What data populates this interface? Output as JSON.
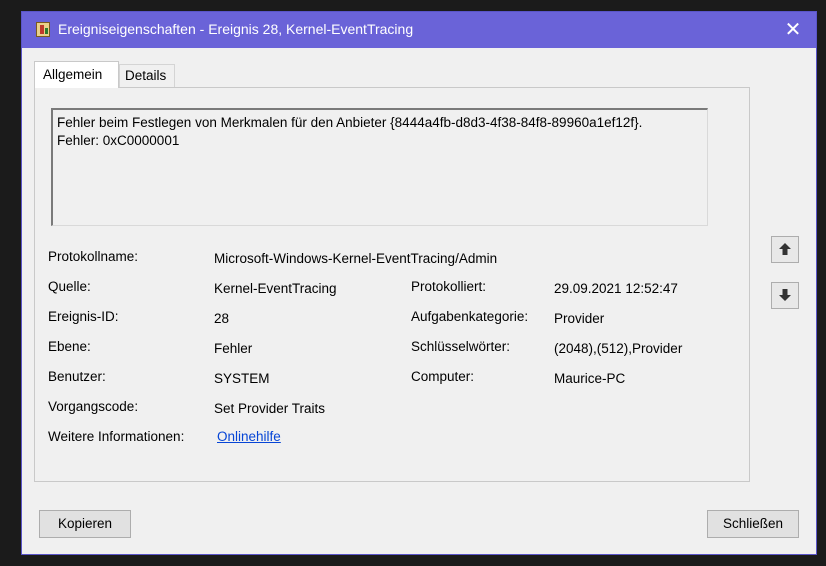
{
  "window": {
    "title": "Ereigniseigenschaften - Ereignis 28, Kernel-EventTracing",
    "close_glyph": "✕"
  },
  "tabs": [
    {
      "label": "Allgemein",
      "active": true
    },
    {
      "label": "Details",
      "active": false
    }
  ],
  "description": {
    "line1": "Fehler beim Festlegen von Merkmalen für den Anbieter {8444a4fb-d8d3-4f38-84f8-89960a1ef12f}.",
    "line2": "Fehler: 0xC0000001"
  },
  "fields": {
    "log_name_label": "Protokollname:",
    "log_name_value": "Microsoft-Windows-Kernel-EventTracing/Admin",
    "source_label": "Quelle:",
    "source_value": "Kernel-EventTracing",
    "logged_label": "Protokolliert:",
    "logged_value": "29.09.2021 12:52:47",
    "event_id_label": "Ereignis-ID:",
    "event_id_value": "28",
    "task_category_label": "Aufgabenkategorie:",
    "task_category_value": "Provider",
    "level_label": "Ebene:",
    "level_value": "Fehler",
    "keywords_label": "Schlüsselwörter:",
    "keywords_value": "(2048),(512),Provider",
    "user_label": "Benutzer:",
    "user_value": "SYSTEM",
    "computer_label": "Computer:",
    "computer_value": "Maurice-PC",
    "opcode_label": "Vorgangscode:",
    "opcode_value": "Set Provider Traits",
    "more_info_label": "Weitere Informationen:",
    "more_info_link": "Onlinehilfe"
  },
  "buttons": {
    "copy": "Kopieren",
    "close": "Schließen"
  },
  "icons": {
    "app": "event-viewer-icon",
    "up": "arrow-up-icon",
    "down": "arrow-down-icon"
  }
}
